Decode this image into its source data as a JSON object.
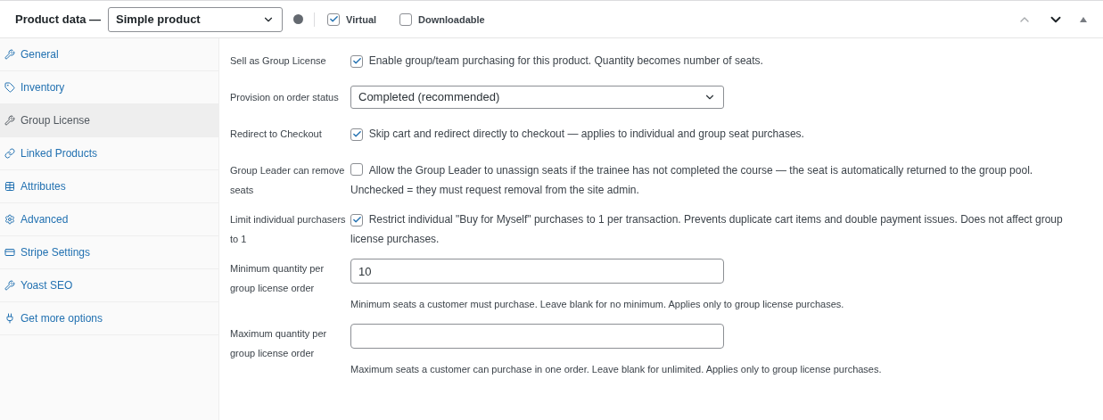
{
  "header": {
    "title": "Product data —",
    "product_type": "Simple product",
    "options": [
      {
        "label": "Virtual",
        "checked": true
      },
      {
        "label": "Downloadable",
        "checked": false
      }
    ]
  },
  "tabs": [
    {
      "label": "General",
      "selected": false
    },
    {
      "label": "Inventory",
      "selected": false
    },
    {
      "label": "Group License",
      "selected": true
    },
    {
      "label": "Linked Products",
      "selected": false
    },
    {
      "label": "Attributes",
      "selected": false
    },
    {
      "label": "Advanced",
      "selected": false
    },
    {
      "label": "Stripe Settings",
      "selected": false
    },
    {
      "label": "Yoast SEO",
      "selected": false
    },
    {
      "label": "Get more options",
      "selected": false
    }
  ],
  "fields": [
    {
      "kind": "checkbox",
      "label": "Sell as Group License",
      "checked": true,
      "text": "Enable group/team purchasing for this product. Quantity becomes number of seats."
    },
    {
      "kind": "select",
      "label": "Provision on order status",
      "value": "Completed (recommended)"
    },
    {
      "kind": "checkbox",
      "label": "Redirect to Checkout",
      "checked": true,
      "text": "Skip cart and redirect directly to checkout — applies to individual and group seat purchases."
    },
    {
      "kind": "checkbox",
      "label": "Group Leader can remove seats",
      "checked": false,
      "text": "Allow the Group Leader to unassign seats if the trainee has not completed the course — the seat is automatically returned to the group pool. Unchecked = they must request removal from the site admin."
    },
    {
      "kind": "checkbox",
      "label": "Limit individual purchasers to 1",
      "checked": true,
      "text": "Restrict individual \"Buy for Myself\" purchases to 1 per transaction. Prevents duplicate cart items and double payment issues. Does not affect group license purchases."
    },
    {
      "kind": "text",
      "label": "Minimum quantity per group license order",
      "value": "10",
      "description": "Minimum seats a customer must purchase. Leave blank for no minimum. Applies only to group license purchases."
    },
    {
      "kind": "text",
      "label": "Maximum quantity per group license order",
      "description": "Maximum seats a customer can purchase in one order. Leave blank for unlimited. Applies only to group license purchases."
    }
  ]
}
